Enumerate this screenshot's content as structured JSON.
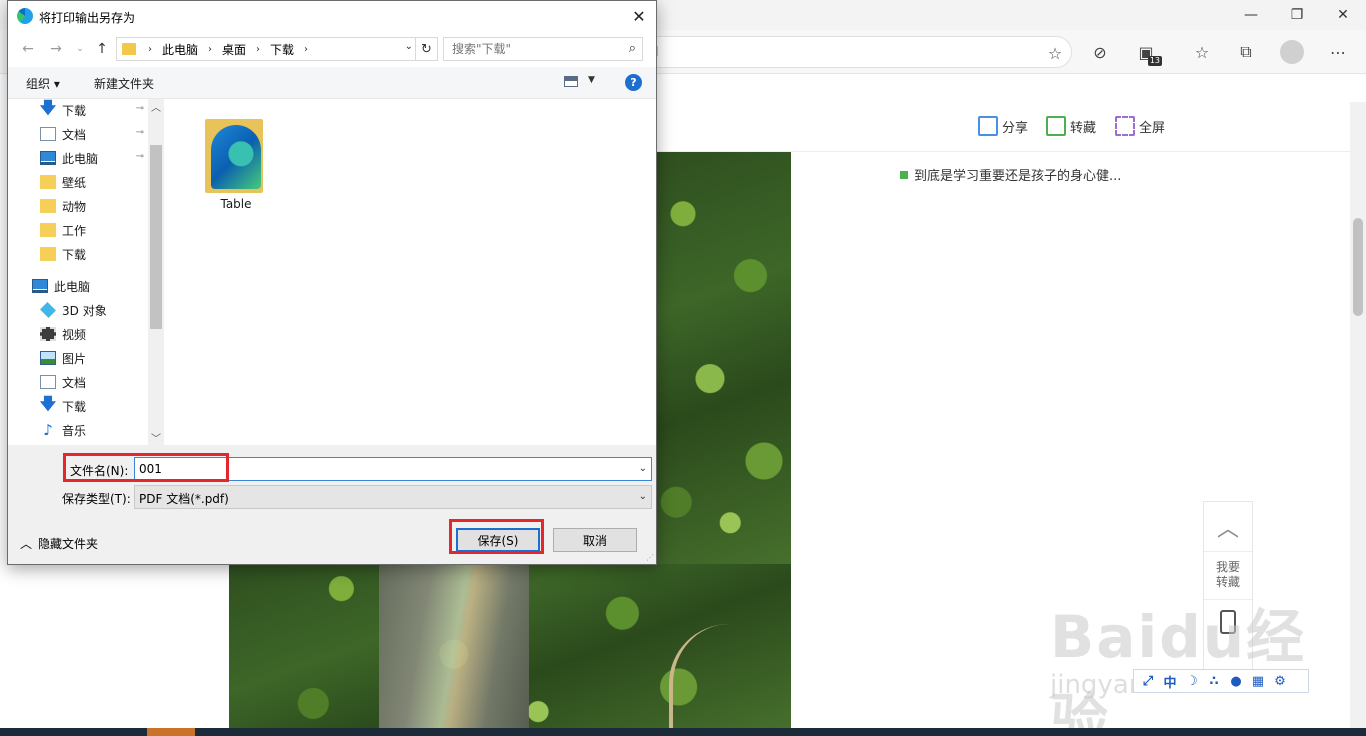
{
  "dialog": {
    "title": "将打印输出另存为",
    "close_glyph": "✕",
    "breadcrumb": [
      "此电脑",
      "桌面",
      "下载"
    ],
    "search_placeholder": "搜索\"下载\"",
    "organize_label": "组织 ▾",
    "new_folder_label": "新建文件夹",
    "help_glyph": "?",
    "nav_items": [
      {
        "label": "下载",
        "icon": "download-arrow-icon",
        "pinned": true
      },
      {
        "label": "文档",
        "icon": "document-icon",
        "pinned": true
      },
      {
        "label": "此电脑",
        "icon": "computer-icon",
        "pinned": true
      },
      {
        "label": "壁纸",
        "icon": "folder-icon"
      },
      {
        "label": "动物",
        "icon": "folder-icon"
      },
      {
        "label": "工作",
        "icon": "folder-icon"
      },
      {
        "label": "下载",
        "icon": "folder-icon"
      },
      {
        "label": "此电脑",
        "icon": "computer-icon"
      },
      {
        "label": "3D 对象",
        "icon": "3d-objects-icon"
      },
      {
        "label": "视频",
        "icon": "video-icon"
      },
      {
        "label": "图片",
        "icon": "pictures-icon"
      },
      {
        "label": "文档",
        "icon": "document-icon"
      },
      {
        "label": "下载",
        "icon": "download-arrow-icon"
      },
      {
        "label": "音乐",
        "icon": "music-icon"
      }
    ],
    "files": [
      {
        "name": "Table"
      }
    ],
    "filename_label": "文件名(N):",
    "filename_value": "001",
    "filetype_label": "保存类型(T):",
    "filetype_value": "PDF 文档(*.pdf)",
    "hide_folders_label": "隐藏文件夹",
    "save_label": "保存(S)",
    "cancel_label": "取消"
  },
  "browser": {
    "address_partial": "l",
    "extension_badge": "13",
    "page_actions": {
      "share": "分享",
      "collect": "转藏",
      "fullscreen": "全屏"
    },
    "related_articles": [
      {
        "text": "到底是学习重要还是孩子的身心健..."
      }
    ],
    "side_widget": {
      "collect_label": "我要\n转藏"
    },
    "watermark": "Baidu经验",
    "watermark_url": "jingyan.baidu.com",
    "ime_items": [
      "⤢",
      "中",
      "☽",
      "∴",
      "●",
      "▦",
      "⚙"
    ],
    "colors": {
      "highlight": "#e5262c",
      "accent": "#1c6fcf",
      "related_marker": "#4caf50"
    }
  }
}
